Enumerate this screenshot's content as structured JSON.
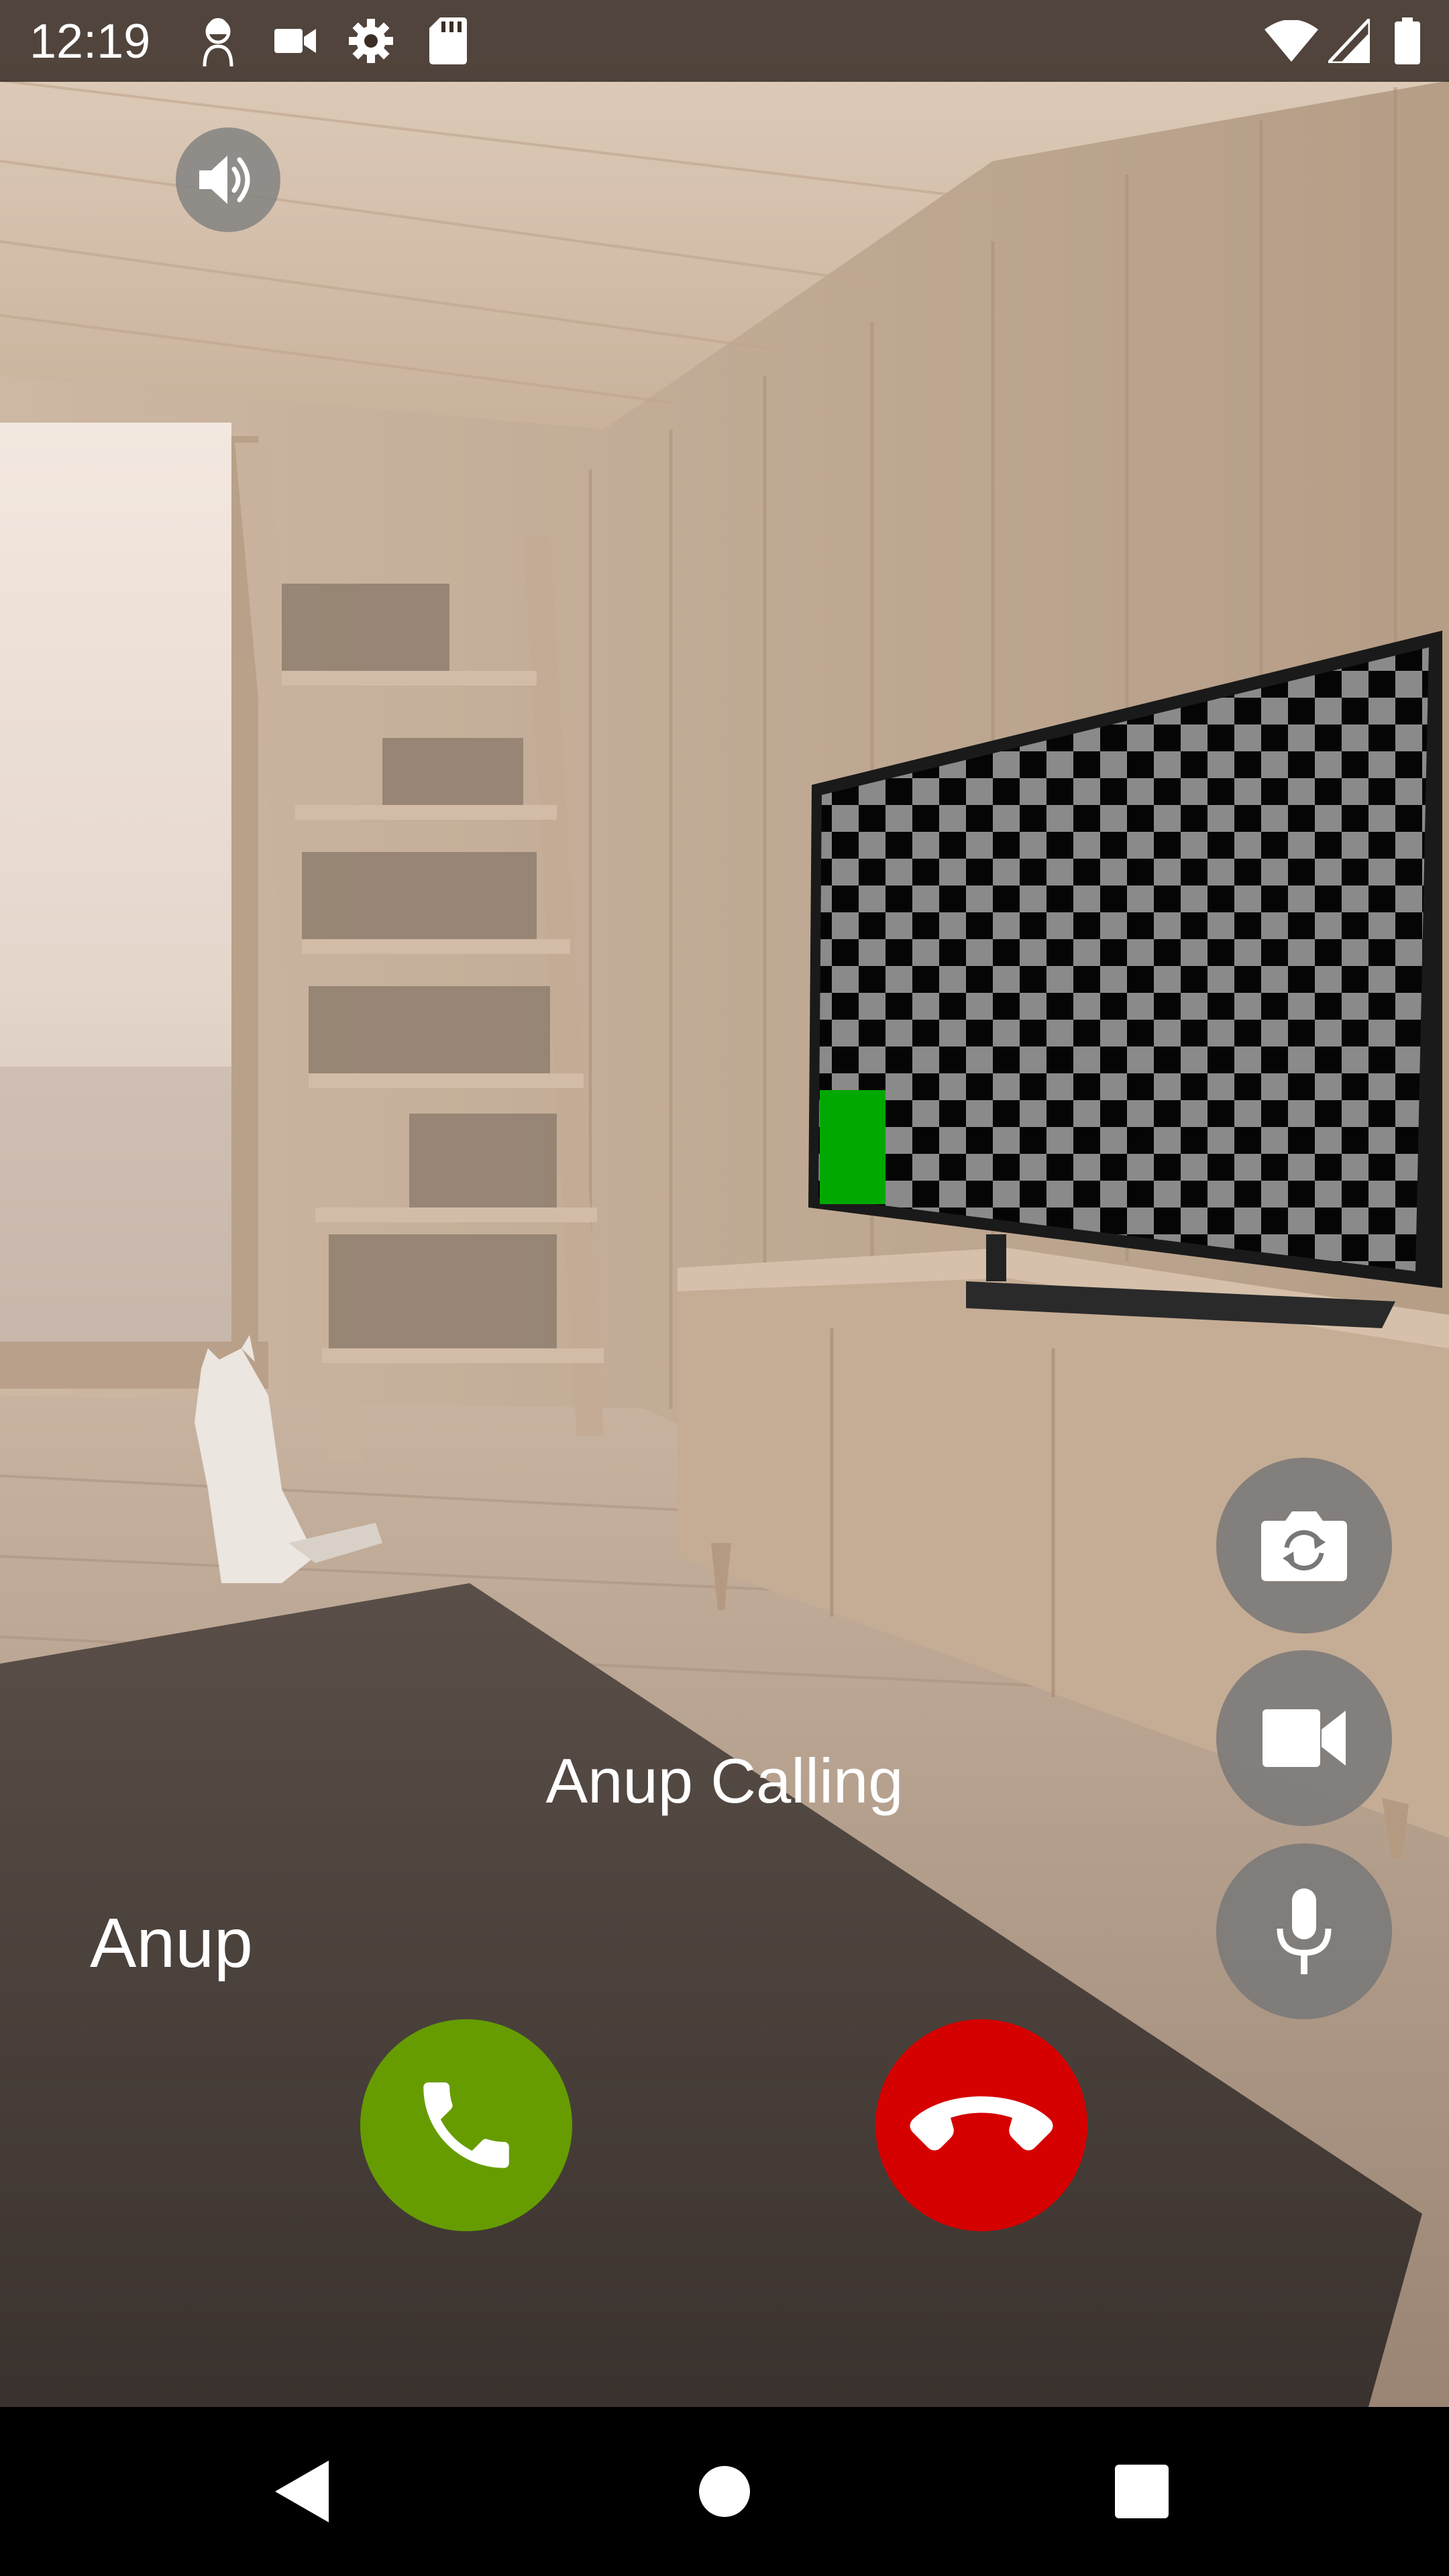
{
  "status_bar": {
    "time": "12:19",
    "icons": [
      "notification-avatar-icon",
      "video-camera-icon",
      "settings-gear-icon",
      "sd-card-icon",
      "wifi-icon",
      "cellular-signal-icon",
      "battery-icon"
    ]
  },
  "call": {
    "status_text": "Anup Calling",
    "caller_name": "Anup"
  },
  "controls": {
    "speaker": "speaker-icon",
    "switch_camera": "switch-camera-icon",
    "video": "video-camera-icon",
    "mute": "microphone-icon",
    "accept": "phone-icon",
    "decline": "hang-up-icon"
  },
  "colors": {
    "accept": "#669c00",
    "decline": "#d50000",
    "control_bg": "#787878"
  },
  "nav_bar": {
    "buttons": [
      "back-icon",
      "home-icon",
      "recents-icon"
    ]
  }
}
